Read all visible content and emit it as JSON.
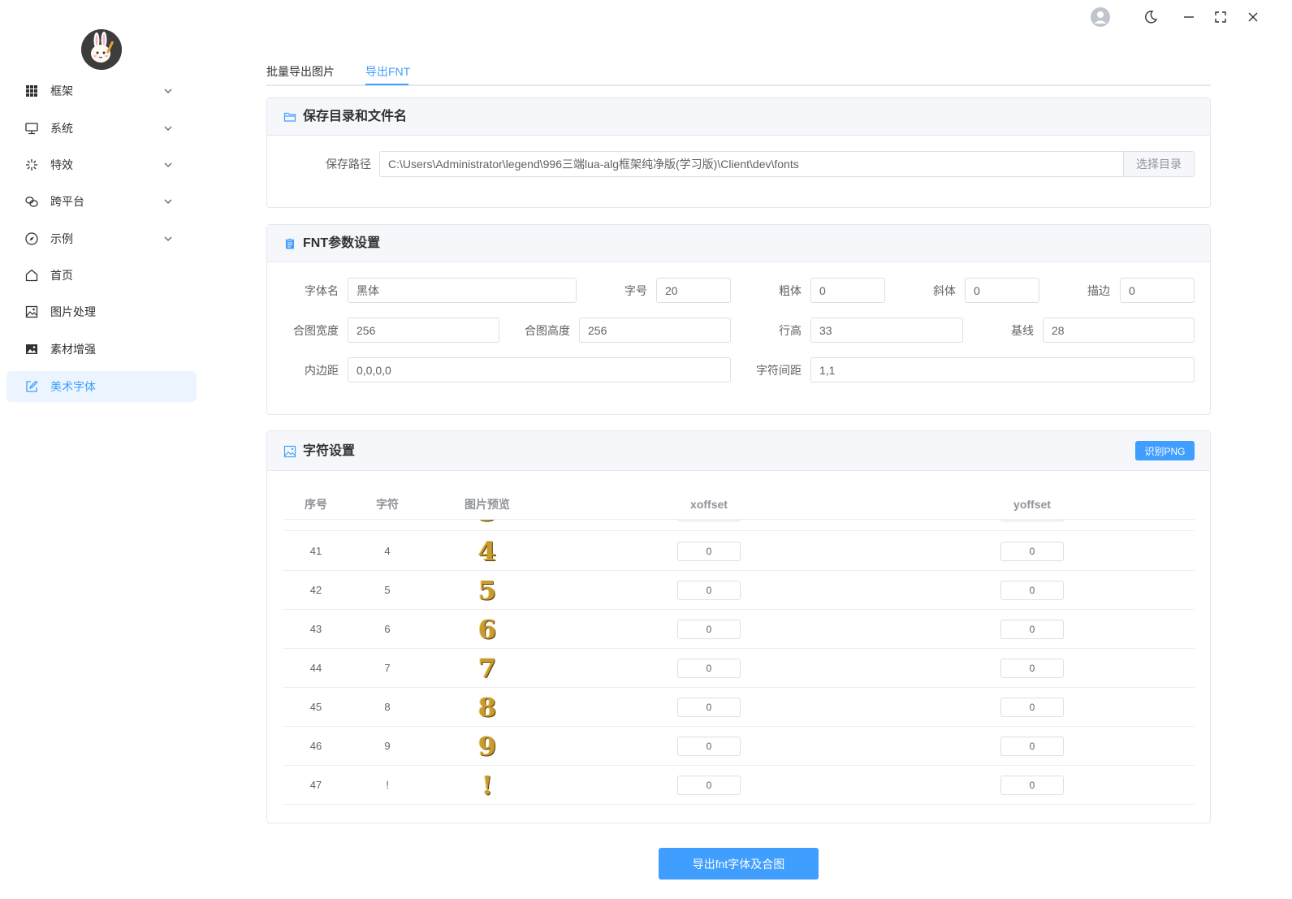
{
  "colors": {
    "accent": "#409eff",
    "active_bg": "#ecf5ff",
    "glyph_gold": "#c89b2f"
  },
  "sidebar": {
    "items": [
      {
        "label": "框架",
        "icon": "grid-icon",
        "expandable": true
      },
      {
        "label": "系统",
        "icon": "monitor-icon",
        "expandable": true
      },
      {
        "label": "特效",
        "icon": "sparkle-icon",
        "expandable": true
      },
      {
        "label": "跨平台",
        "icon": "link-icon",
        "expandable": true
      },
      {
        "label": "示例",
        "icon": "compass-icon",
        "expandable": true
      },
      {
        "label": "首页",
        "icon": "home-icon",
        "expandable": false
      },
      {
        "label": "图片处理",
        "icon": "picture-icon",
        "expandable": false
      },
      {
        "label": "素材增强",
        "icon": "image-filled-icon",
        "expandable": false
      },
      {
        "label": "美术字体",
        "icon": "edit-icon",
        "expandable": false,
        "active": true
      }
    ]
  },
  "window_controls": [
    "user-avatar-icon",
    "moon-icon",
    "minimize-icon",
    "fullscreen-icon",
    "close-icon"
  ],
  "tabs": [
    {
      "label": "批量导出图片",
      "active": false
    },
    {
      "label": "导出FNT",
      "active": true
    }
  ],
  "save_section": {
    "title": "保存目录和文件名",
    "path_label": "保存路径",
    "path_value": "C:\\Users\\Administrator\\legend\\996三端lua-alg框架纯净版(学习版)\\Client\\dev\\fonts",
    "choose_dir_label": "选择目录"
  },
  "fnt_section": {
    "title": "FNT参数设置",
    "font_name_label": "字体名",
    "font_name": "黑体",
    "font_size_label": "字号",
    "font_size": "20",
    "bold_label": "粗体",
    "bold": "0",
    "italic_label": "斜体",
    "italic": "0",
    "outline_label": "描边",
    "outline": "0",
    "atlas_width_label": "合图宽度",
    "atlas_width": "256",
    "atlas_height_label": "合图高度",
    "atlas_height": "256",
    "line_height_label": "行高",
    "line_height": "33",
    "baseline_label": "基线",
    "baseline": "28",
    "padding_label": "内边距",
    "padding": "0,0,0,0",
    "spacing_label": "字符间距",
    "spacing": "1,1"
  },
  "char_section": {
    "title": "字符设置",
    "recognize_label": "识别PNG",
    "columns": [
      "序号",
      "字符",
      "图片预览",
      "xoffset",
      "yoffset"
    ],
    "rows": [
      {
        "index": "41",
        "char": "4",
        "xoffset": "0",
        "yoffset": "0"
      },
      {
        "index": "42",
        "char": "5",
        "xoffset": "0",
        "yoffset": "0"
      },
      {
        "index": "43",
        "char": "6",
        "xoffset": "0",
        "yoffset": "0"
      },
      {
        "index": "44",
        "char": "7",
        "xoffset": "0",
        "yoffset": "0"
      },
      {
        "index": "45",
        "char": "8",
        "xoffset": "0",
        "yoffset": "0"
      },
      {
        "index": "46",
        "char": "9",
        "xoffset": "0",
        "yoffset": "0"
      },
      {
        "index": "47",
        "char": "!",
        "xoffset": "0",
        "yoffset": "0"
      }
    ]
  },
  "export_button_label": "导出fnt字体及合图"
}
